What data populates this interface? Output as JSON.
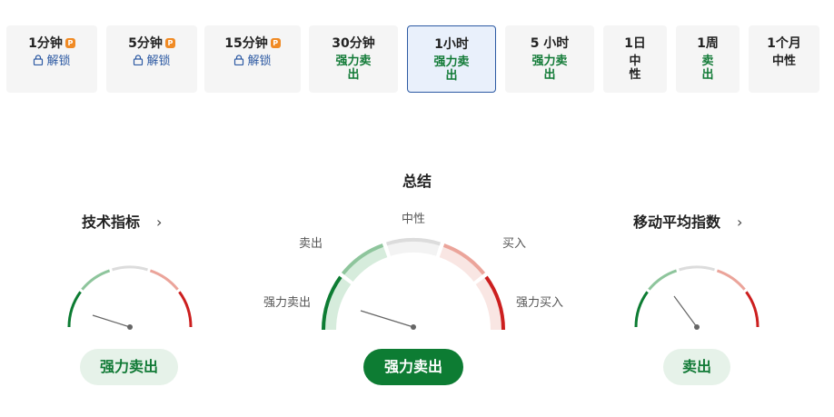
{
  "tabs": [
    {
      "label": "1分钟",
      "premium": true,
      "status": "解锁",
      "status_type": "unlock"
    },
    {
      "label": "5分钟",
      "premium": true,
      "status": "解锁",
      "status_type": "unlock"
    },
    {
      "label": "15分钟",
      "premium": true,
      "status": "解锁",
      "status_type": "unlock"
    },
    {
      "label": "30分钟",
      "premium": false,
      "status": "强力卖出",
      "status_type": "sell"
    },
    {
      "label": "1小时",
      "premium": false,
      "status": "强力卖出",
      "status_type": "sell",
      "active": true
    },
    {
      "label": "5 小时",
      "premium": false,
      "status": "强力卖出",
      "status_type": "sell"
    },
    {
      "label": "1日",
      "premium": false,
      "status": "中性",
      "status_type": "neutral"
    },
    {
      "label": "1周",
      "premium": false,
      "status": "卖出",
      "status_type": "sell"
    },
    {
      "label": "1个月",
      "premium": false,
      "status": "中性",
      "status_type": "neutral"
    }
  ],
  "premium_badge": "P",
  "summary": {
    "title": "总结",
    "labels": {
      "strong_sell": "强力卖出",
      "sell": "卖出",
      "neutral": "中性",
      "buy": "买入",
      "strong_buy": "强力买入"
    },
    "result": "强力卖出"
  },
  "technical": {
    "title": "技术指标",
    "result": "强力卖出"
  },
  "moving_averages": {
    "title": "移动平均指数",
    "result": "卖出"
  },
  "colors": {
    "strong_sell": "#0d7c33",
    "sell": "#8ec59c",
    "neutral": "#dcdcdc",
    "buy": "#eba49a",
    "strong_buy": "#cc1f1f"
  }
}
